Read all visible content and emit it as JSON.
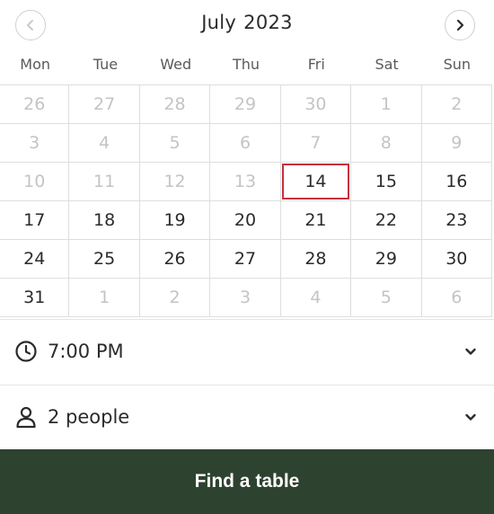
{
  "calendar": {
    "month": "July",
    "year": "2023",
    "weekdays": [
      "Mon",
      "Tue",
      "Wed",
      "Thu",
      "Fri",
      "Sat",
      "Sun"
    ],
    "days": [
      {
        "label": "26",
        "state": "muted"
      },
      {
        "label": "27",
        "state": "muted"
      },
      {
        "label": "28",
        "state": "muted"
      },
      {
        "label": "29",
        "state": "muted"
      },
      {
        "label": "30",
        "state": "muted"
      },
      {
        "label": "1",
        "state": "muted"
      },
      {
        "label": "2",
        "state": "muted"
      },
      {
        "label": "3",
        "state": "muted"
      },
      {
        "label": "4",
        "state": "muted"
      },
      {
        "label": "5",
        "state": "muted"
      },
      {
        "label": "6",
        "state": "muted"
      },
      {
        "label": "7",
        "state": "muted"
      },
      {
        "label": "8",
        "state": "muted"
      },
      {
        "label": "9",
        "state": "muted"
      },
      {
        "label": "10",
        "state": "muted"
      },
      {
        "label": "11",
        "state": "muted"
      },
      {
        "label": "12",
        "state": "muted"
      },
      {
        "label": "13",
        "state": "muted"
      },
      {
        "label": "14",
        "state": "selected"
      },
      {
        "label": "15",
        "state": "available"
      },
      {
        "label": "16",
        "state": "available"
      },
      {
        "label": "17",
        "state": "available"
      },
      {
        "label": "18",
        "state": "available"
      },
      {
        "label": "19",
        "state": "available"
      },
      {
        "label": "20",
        "state": "available"
      },
      {
        "label": "21",
        "state": "available"
      },
      {
        "label": "22",
        "state": "available"
      },
      {
        "label": "23",
        "state": "available"
      },
      {
        "label": "24",
        "state": "available"
      },
      {
        "label": "25",
        "state": "available"
      },
      {
        "label": "26",
        "state": "available"
      },
      {
        "label": "27",
        "state": "available"
      },
      {
        "label": "28",
        "state": "available"
      },
      {
        "label": "29",
        "state": "available"
      },
      {
        "label": "30",
        "state": "available"
      },
      {
        "label": "31",
        "state": "available"
      },
      {
        "label": "1",
        "state": "muted"
      },
      {
        "label": "2",
        "state": "muted"
      },
      {
        "label": "3",
        "state": "muted"
      },
      {
        "label": "4",
        "state": "muted"
      },
      {
        "label": "5",
        "state": "muted"
      },
      {
        "label": "6",
        "state": "muted"
      }
    ],
    "prev_icon": "chevron-left-icon",
    "next_icon": "chevron-right-icon"
  },
  "time": {
    "value": "7:00 PM",
    "icon": "clock-icon",
    "chevron_icon": "chevron-down-icon"
  },
  "party": {
    "value": "2 people",
    "icon": "person-icon",
    "chevron_icon": "chevron-down-icon"
  },
  "find_button": {
    "label": "Find a table"
  },
  "colors": {
    "accent": "#c8303a",
    "button_bg": "#2e4230",
    "muted_text": "#c4c4c4"
  }
}
